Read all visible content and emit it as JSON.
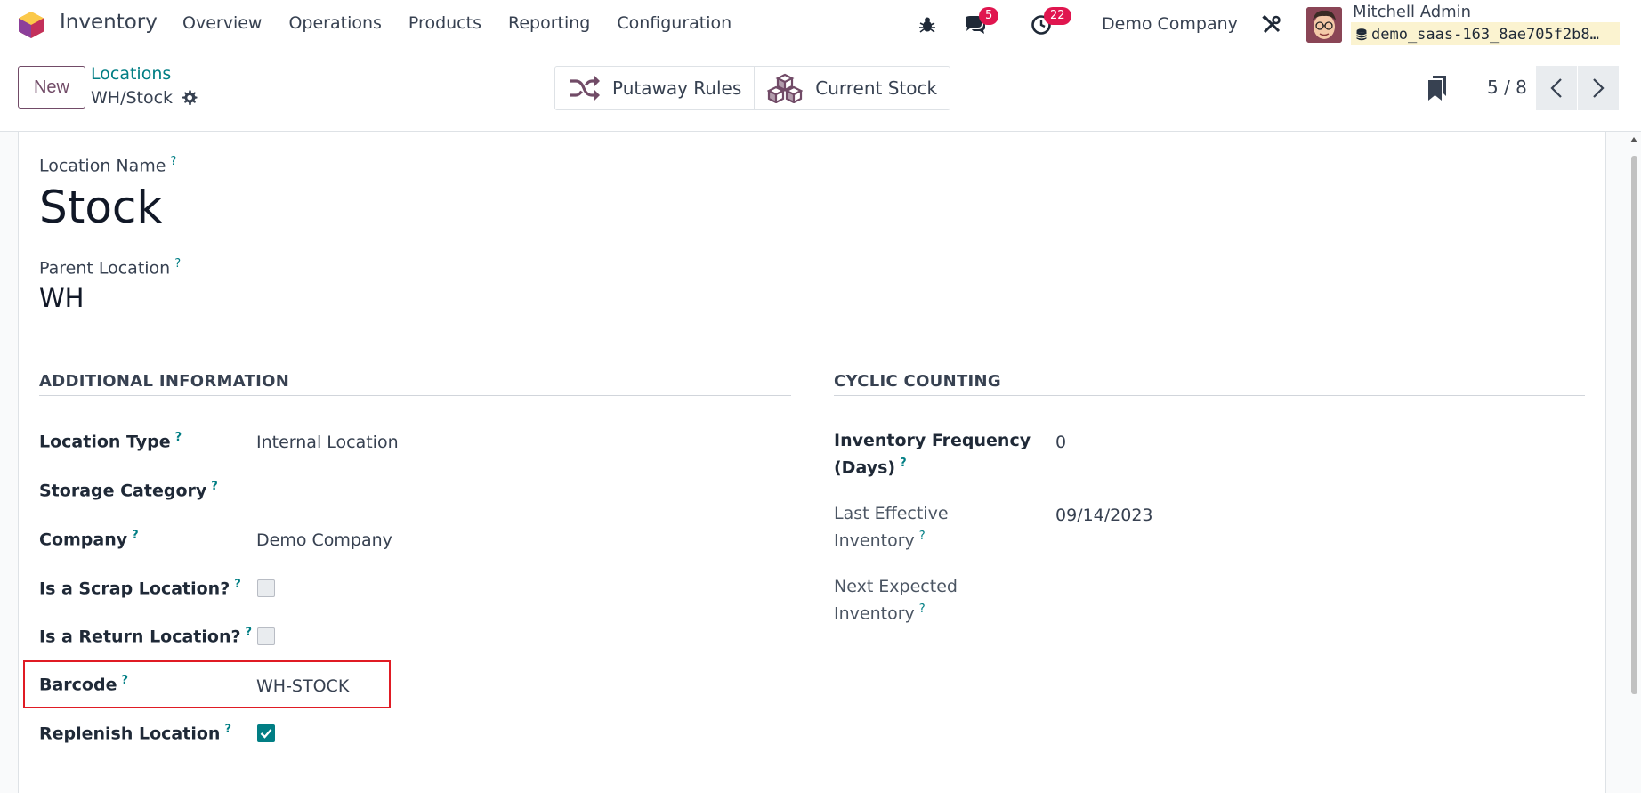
{
  "app": {
    "name": "Inventory",
    "menu": [
      "Overview",
      "Operations",
      "Products",
      "Reporting",
      "Configuration"
    ]
  },
  "systray": {
    "messages_count": "5",
    "activities_count": "22",
    "company": "Demo Company",
    "user_name": "Mitchell Admin",
    "database": "demo_saas-163_8ae705f2b8…"
  },
  "control_panel": {
    "new_label": "New",
    "breadcrumb": "Locations",
    "record_name": "WH/Stock",
    "smart_buttons": [
      "Putaway Rules",
      "Current Stock"
    ],
    "pager": "5 / 8"
  },
  "form": {
    "location_name_label": "Location Name",
    "location_name": "Stock",
    "parent_location_label": "Parent Location",
    "parent_location": "WH",
    "help_mark": "?",
    "additional": {
      "title": "ADDITIONAL INFORMATION",
      "location_type_label": "Location Type",
      "location_type": "Internal Location",
      "storage_category_label": "Storage Category",
      "storage_category": "",
      "company_label": "Company",
      "company": "Demo Company",
      "scrap_label": "Is a Scrap Location?",
      "scrap_checked": false,
      "return_label": "Is a Return Location?",
      "return_checked": false,
      "barcode_label": "Barcode",
      "barcode": "WH-STOCK",
      "replenish_label": "Replenish Location",
      "replenish_checked": true
    },
    "cyclic": {
      "title": "CYCLIC COUNTING",
      "frequency_label_1": "Inventory Frequency",
      "frequency_label_2": "(Days)",
      "frequency": "0",
      "last_label_1": "Last Effective",
      "last_label_2": "Inventory",
      "last": "09/14/2023",
      "next_label_1": "Next Expected",
      "next_label_2": "Inventory",
      "next": ""
    }
  },
  "colors": {
    "primary": "#714b67",
    "accent": "#017e84",
    "badge": "#e0164f",
    "highlight": "#e01b24"
  },
  "icons": [
    "app-logo-icon",
    "bug-icon",
    "chat-icon",
    "clock-icon",
    "tools-icon",
    "database-icon",
    "gear-icon",
    "shuffle-icon",
    "cubes-icon",
    "bookmark-icon",
    "chevron-left-icon",
    "chevron-right-icon",
    "check-icon"
  ]
}
